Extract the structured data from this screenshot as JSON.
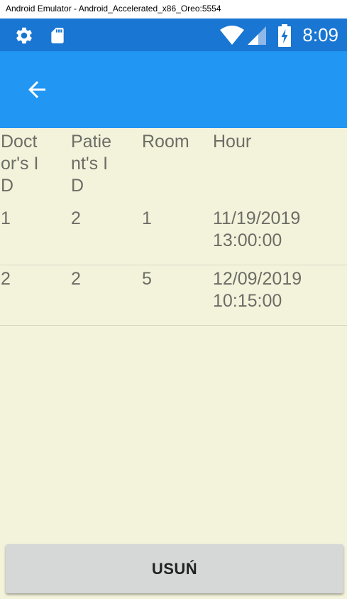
{
  "window": {
    "title": "Android Emulator - Android_Accelerated_x86_Oreo:5554"
  },
  "status_bar": {
    "time": "8:09",
    "left_icons": [
      "gear-icon",
      "sd-card-icon"
    ],
    "right_icons": [
      "wifi-icon",
      "cell-signal-icon",
      "battery-charging-icon"
    ],
    "color": "#1976d2"
  },
  "action_bar": {
    "back_icon": "arrow-left-icon",
    "color": "#2196f3"
  },
  "table": {
    "headers": [
      "Doctor's ID",
      "Patient's ID",
      "Room",
      "Hour"
    ],
    "rows": [
      [
        "1",
        "2",
        "1",
        "11/19/2019 13:00:00"
      ],
      [
        "2",
        "2",
        "5",
        "12/09/2019 10:15:00"
      ]
    ],
    "background": "#f3f3dc"
  },
  "actions": {
    "delete_label": "USUŃ"
  }
}
